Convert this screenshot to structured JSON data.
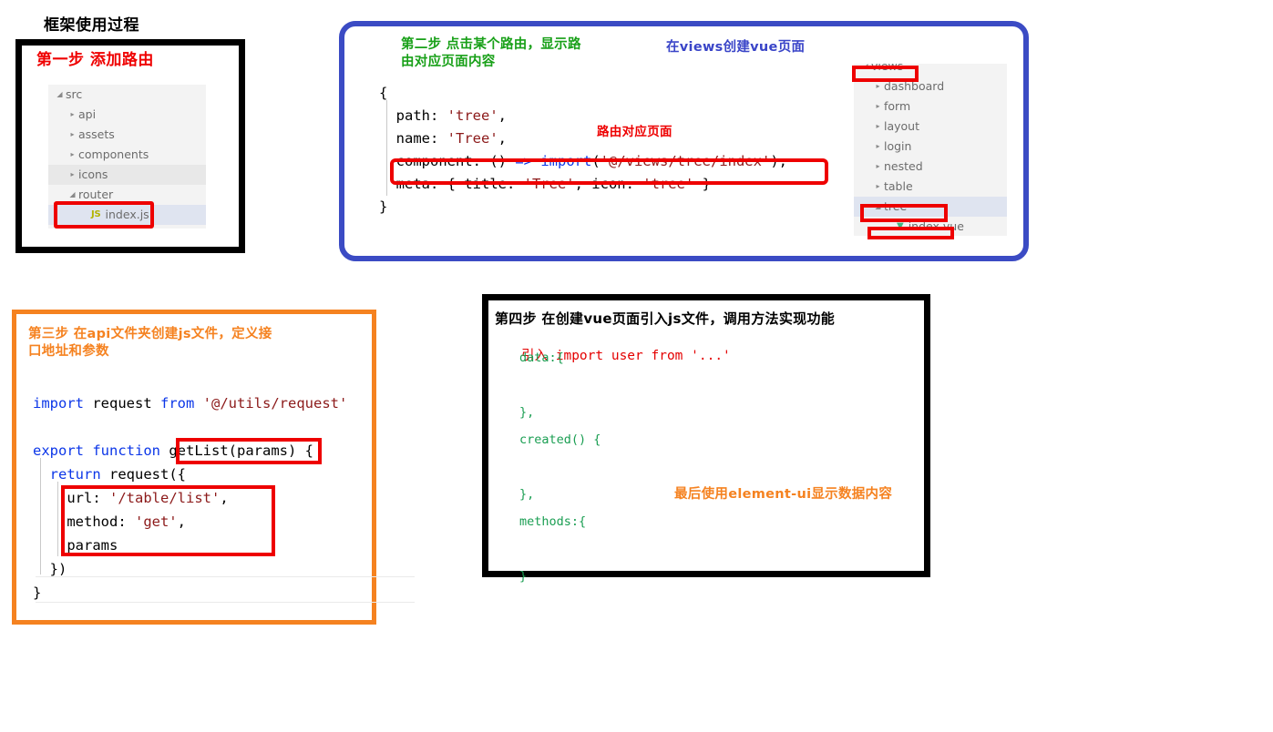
{
  "page": {
    "title": "框架使用过程"
  },
  "step1": {
    "heading": "第一步  添加路由",
    "tree": {
      "name": "src-file-tree",
      "rows": [
        {
          "label": "src",
          "indent": 0,
          "twisty": "expanded",
          "state": "normal",
          "icon": ""
        },
        {
          "label": "api",
          "indent": 1,
          "twisty": "collapsed",
          "state": "normal",
          "icon": ""
        },
        {
          "label": "assets",
          "indent": 1,
          "twisty": "collapsed",
          "state": "normal",
          "icon": ""
        },
        {
          "label": "components",
          "indent": 1,
          "twisty": "collapsed",
          "state": "normal",
          "icon": ""
        },
        {
          "label": "icons",
          "indent": 1,
          "twisty": "collapsed",
          "state": "hover",
          "icon": ""
        },
        {
          "label": "router",
          "indent": 1,
          "twisty": "expanded",
          "state": "normal",
          "icon": ""
        },
        {
          "label": "index.js",
          "indent": 2,
          "twisty": "none",
          "state": "selected",
          "icon": "JS"
        }
      ]
    }
  },
  "step2": {
    "heading": "第二步  点击某个路由，显示路\n由对应页面内容",
    "subheading": "在views创建vue页面",
    "note": "路由对应页面",
    "code_lines": [
      "{",
      "  path: 'tree',",
      "  name: 'Tree',",
      "  component: () => import('@/views/tree/index'),",
      "  meta: { title: 'Tree', icon: 'tree' }",
      "}"
    ],
    "tree": {
      "name": "views-file-tree",
      "rows": [
        {
          "label": "views",
          "indent": 0,
          "twisty": "expanded",
          "state": "normal",
          "icon": ""
        },
        {
          "label": "dashboard",
          "indent": 1,
          "twisty": "collapsed",
          "state": "normal",
          "icon": ""
        },
        {
          "label": "form",
          "indent": 1,
          "twisty": "collapsed",
          "state": "normal",
          "icon": ""
        },
        {
          "label": "layout",
          "indent": 1,
          "twisty": "collapsed",
          "state": "normal",
          "icon": ""
        },
        {
          "label": "login",
          "indent": 1,
          "twisty": "collapsed",
          "state": "normal",
          "icon": ""
        },
        {
          "label": "nested",
          "indent": 1,
          "twisty": "collapsed",
          "state": "normal",
          "icon": ""
        },
        {
          "label": "table",
          "indent": 1,
          "twisty": "collapsed",
          "state": "normal",
          "icon": ""
        },
        {
          "label": "tree",
          "indent": 1,
          "twisty": "expanded",
          "state": "selected",
          "icon": ""
        },
        {
          "label": "index.vue",
          "indent": 2,
          "twisty": "none",
          "state": "normal",
          "icon": "V"
        }
      ]
    }
  },
  "step3": {
    "heading": "第三步  在api文件夹创建js文件，定义接\n口地址和参数",
    "code_lines": [
      "import request from '@/utils/request'",
      "",
      "export function getList(params) {",
      "  return request({",
      "    url: '/table/list',",
      "    method: 'get',",
      "    params",
      "  })",
      "}"
    ]
  },
  "step4": {
    "heading": "第四步  在创建vue页面引入js文件，调用方法实现功能",
    "import_label": "引入",
    "import_code": "import user from '...'",
    "note": "最后使用element-ui显示数据内容",
    "code_lines": [
      "data:{",
      "",
      "},",
      "created() {",
      "",
      "},",
      "methods:{",
      "",
      "}"
    ]
  },
  "colors": {
    "red_annotation": "#ee0000",
    "blue_border": "#3b4bc4",
    "orange_border": "#f58220",
    "green_heading": "#18a018",
    "blue_heading": "#3a45c8",
    "code_keyword_blue": "#0b36e8",
    "code_string_red": "#8c1a1a",
    "code_green": "#1a9e52"
  }
}
